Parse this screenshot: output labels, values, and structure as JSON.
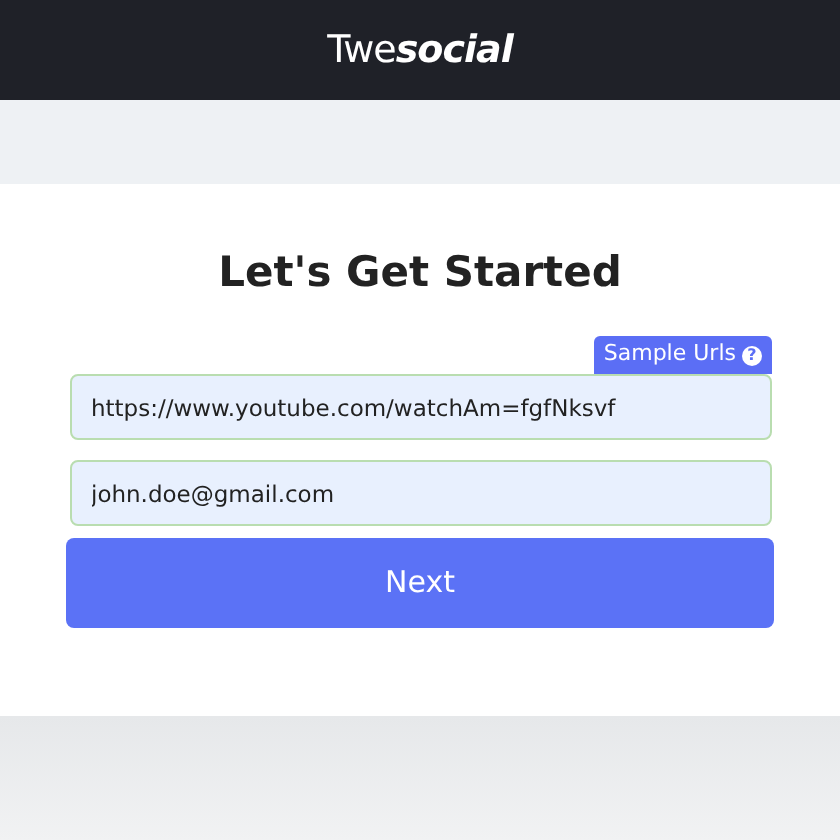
{
  "header": {
    "logo": "Twe**social**"
  },
  "title": "Let's Get Started",
  "sample_button": {
    "label": "Sample Urls",
    "icon": "?"
  },
  "fields": [
    {
      "value": "https://www.youtube.com/watchAm=fgfNksvf"
    },
    {
      "value": "john.doe@gmail.com"
    }
  ],
  "submit_button": {
    "label": "Next"
  }
}
